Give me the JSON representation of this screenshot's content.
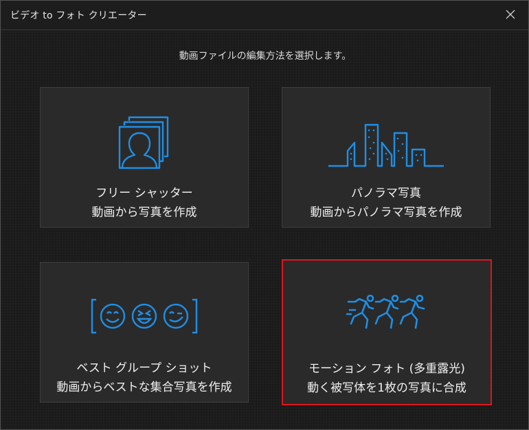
{
  "window": {
    "title": "ビデオ to フォト クリエーター",
    "close_icon": "close-icon"
  },
  "instruction": "動画ファイルの編集方法を選択します。",
  "accent_color": "#1e8fe6",
  "selection_color": "#e0161e",
  "options": [
    {
      "id": "free-shutter",
      "line1": "フリー シャッター",
      "line2": "動画から写真を作成",
      "icon": "portrait-frames-icon",
      "selected": false
    },
    {
      "id": "panorama",
      "line1": "パノラマ写真",
      "line2": "動画からパノラマ写真を作成",
      "icon": "city-skyline-icon",
      "selected": false
    },
    {
      "id": "best-group-shot",
      "line1": "ベスト グループ ショット",
      "line2": "動画からベストな集合写真を作成",
      "icon": "smiley-group-icon",
      "selected": false
    },
    {
      "id": "motion-photo",
      "line1": "モーション フォト (多重露光)",
      "line2": "動く被写体を1枚の写真に合成",
      "icon": "running-figures-icon",
      "selected": true
    }
  ]
}
